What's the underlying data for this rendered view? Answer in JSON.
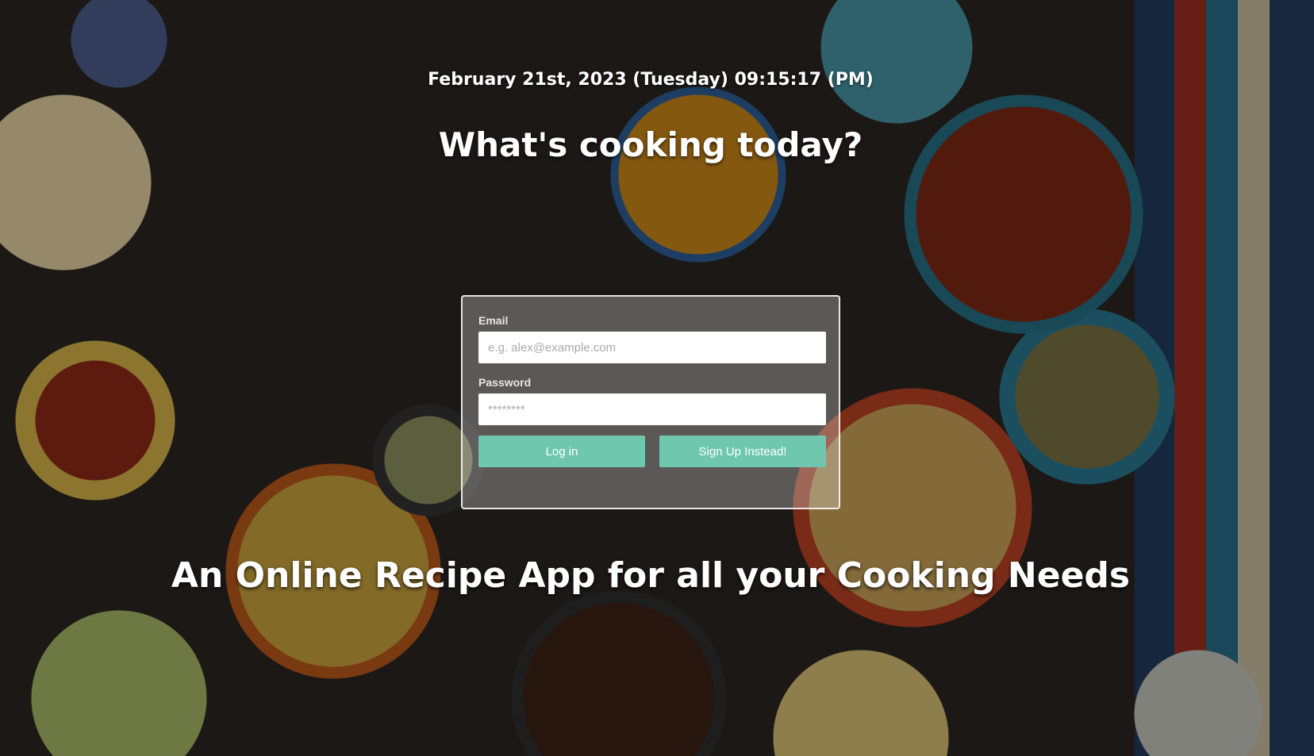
{
  "header": {
    "datetime": "February 21st, 2023 (Tuesday) 09:15:17 (PM)",
    "headline": "What's cooking today?"
  },
  "login": {
    "email_label": "Email",
    "email_placeholder": "e.g. alex@example.com",
    "email_value": "",
    "password_label": "Password",
    "password_placeholder": "********",
    "password_value": "",
    "login_button": "Log in",
    "signup_button": "Sign Up Instead!"
  },
  "tagline": "An Online Recipe App for all your Cooking Needs",
  "colors": {
    "button": "#6fc8ae",
    "text": "#ffffff"
  }
}
